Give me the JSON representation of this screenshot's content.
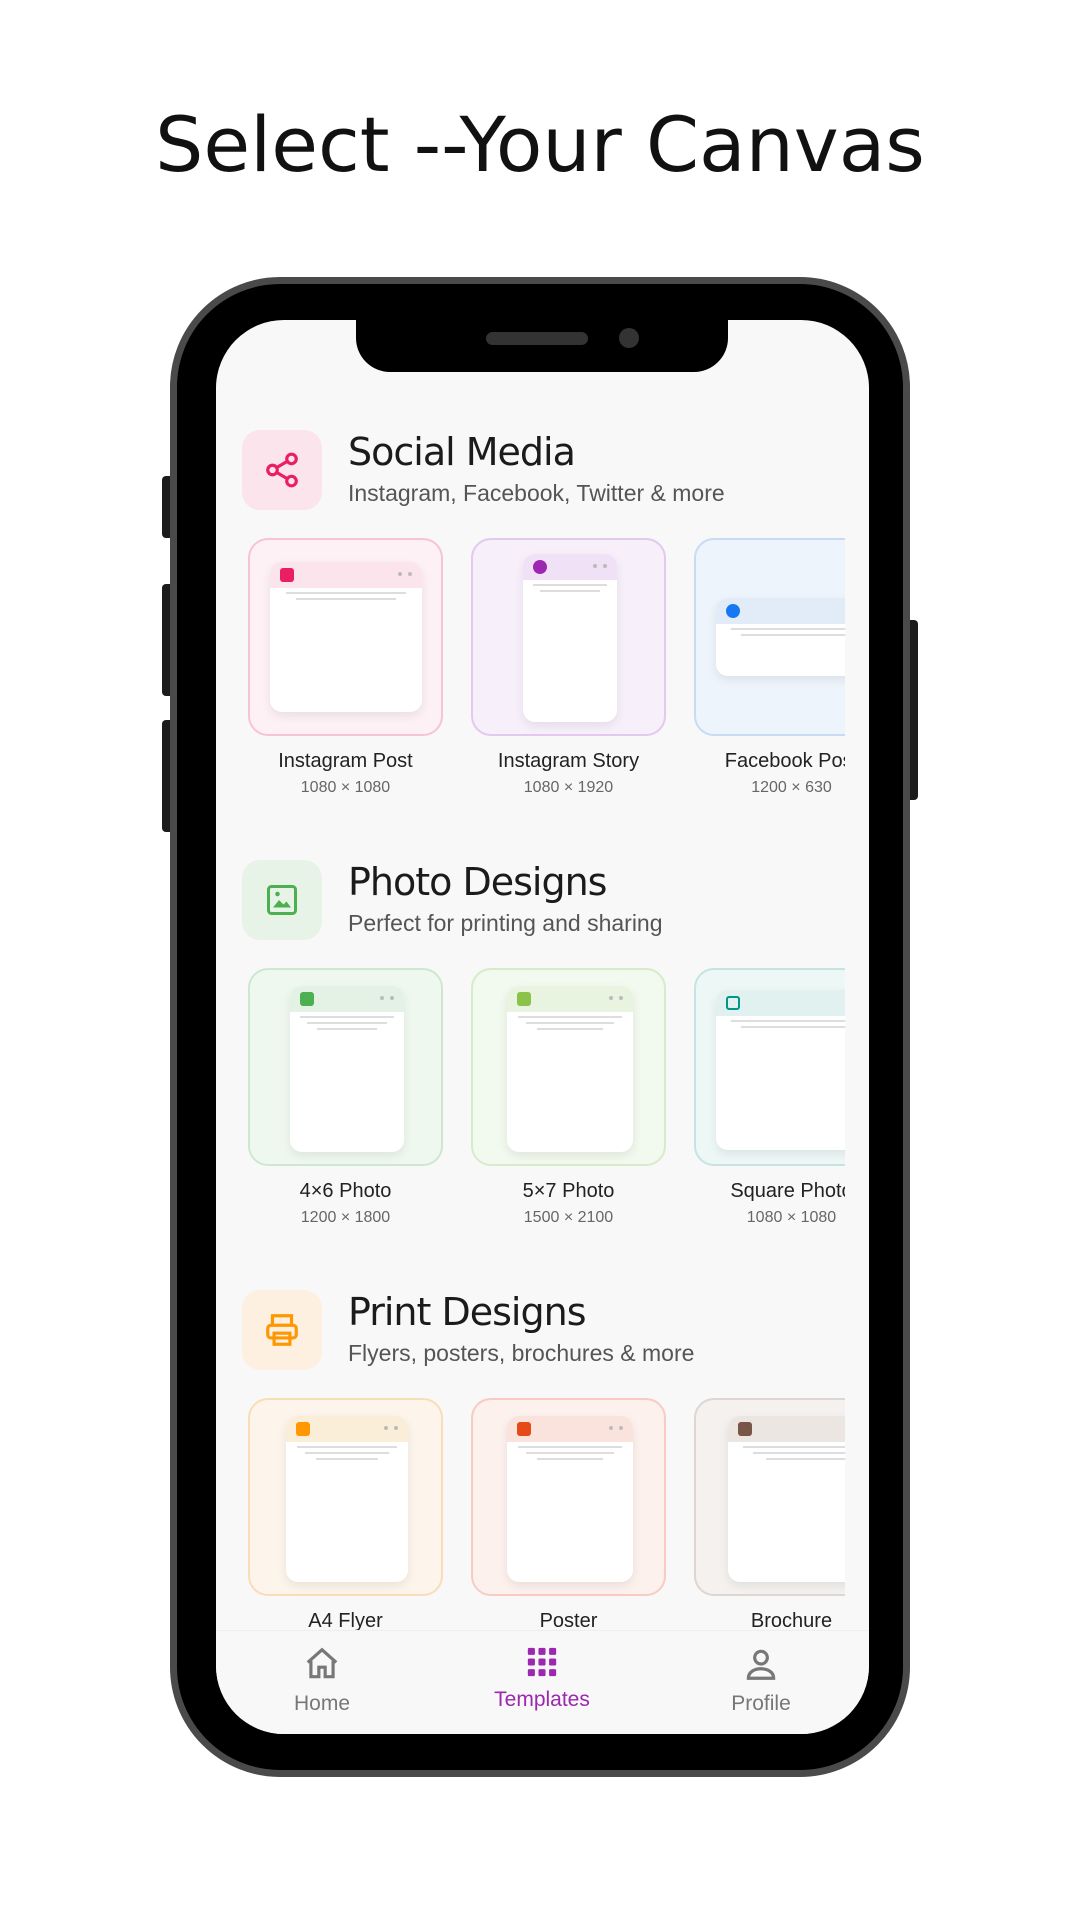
{
  "headline": "Select --Your Canvas",
  "sections": [
    {
      "title": "Social Media",
      "subtitle": "Instagram, Facebook, Twitter & more",
      "icon": "share-icon",
      "accent": "#e91e63",
      "cards": [
        {
          "name": "Instagram Post",
          "size": "1080 × 1080",
          "icon": "camera-icon"
        },
        {
          "name": "Instagram Story",
          "size": "1080 × 1920",
          "icon": "aperture-icon"
        },
        {
          "name": "Facebook Post",
          "size": "1200 × 630",
          "icon": "facebook-icon"
        }
      ]
    },
    {
      "title": "Photo Designs",
      "subtitle": "Perfect for printing and sharing",
      "icon": "image-icon",
      "accent": "#4caf50",
      "cards": [
        {
          "name": "4×6 Photo",
          "size": "1200 × 1800",
          "icon": "image-icon"
        },
        {
          "name": "5×7 Photo",
          "size": "1500 × 2100",
          "icon": "image-icon"
        },
        {
          "name": "Square Photo",
          "size": "1080 × 1080",
          "icon": "square-icon"
        }
      ]
    },
    {
      "title": "Print Designs",
      "subtitle": "Flyers, posters, brochures & more",
      "icon": "printer-icon",
      "accent": "#ff9800",
      "cards": [
        {
          "name": "A4 Flyer",
          "size": "",
          "icon": "document-icon"
        },
        {
          "name": "Poster",
          "size": "",
          "icon": "alert-icon"
        },
        {
          "name": "Brochure",
          "size": "",
          "icon": "book-icon"
        }
      ]
    }
  ],
  "tabs": [
    {
      "label": "Home",
      "icon": "home-icon",
      "active": false
    },
    {
      "label": "Templates",
      "icon": "grid-icon",
      "active": true
    },
    {
      "label": "Profile",
      "icon": "person-icon",
      "active": false
    }
  ]
}
